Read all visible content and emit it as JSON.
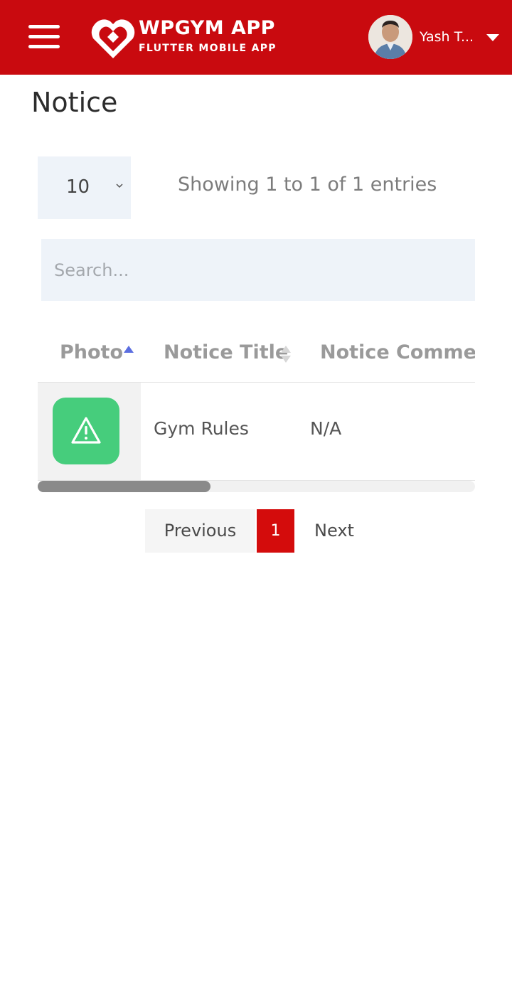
{
  "header": {
    "app_title": "WPGYM APP",
    "app_subtitle": "FLUTTER MOBILE APP",
    "user_name": "Yash T...",
    "brand_color": "#c90a0f",
    "icons": {
      "menu": "hamburger-menu-icon",
      "logo": "heart-logo-icon",
      "user_dropdown": "caret-down-icon"
    }
  },
  "page": {
    "title": "Notice"
  },
  "table_controls": {
    "page_length": "10",
    "entries_info": "Showing 1 to 1 of 1 entries",
    "search_placeholder": "Search..."
  },
  "table": {
    "columns": [
      "Photo",
      "Notice Title",
      "Notice Comme"
    ],
    "rows": [
      {
        "photo_icon": "warning-icon",
        "title": "Gym Rules",
        "comment": "N/A"
      }
    ],
    "notice_icon_color": "#46cd7c",
    "sort_color": "#5b6ee0"
  },
  "pagination": {
    "previous_label": "Previous",
    "current_page": "1",
    "next_label": "Next",
    "active_color": "#d40c0c"
  }
}
